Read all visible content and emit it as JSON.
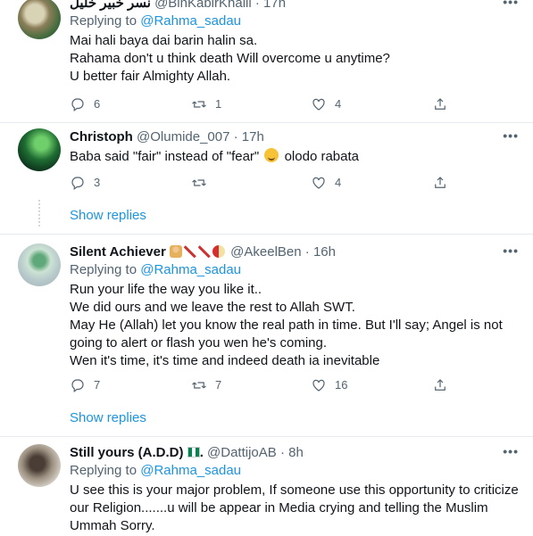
{
  "tweets": [
    {
      "name": "نسر خبير خليل",
      "handle": "@BinKabirKhalil",
      "time": "17h",
      "replying_label": "Replying to",
      "replying_to": "@Rahma_sadau",
      "lines": [
        "Mai hali baya dai barin halin sa.",
        "Rahama don't u think death Will overcome u anytime?",
        "U better fair Almighty Allah."
      ],
      "replies": "6",
      "retweets": "1",
      "likes": "4"
    },
    {
      "name": "Christoph",
      "handle": "@Olumide_007",
      "time": "17h",
      "text_before_emoji": "Baba said \"fair\" instead of \"fear\"",
      "text_after_emoji": "olodo rabata",
      "emoji": "face-with-tears-of-joy",
      "replies": "3",
      "retweets": "",
      "likes": "4",
      "show_replies": "Show replies"
    },
    {
      "name": "Silent Achiever",
      "name_emojis": [
        "person-icon",
        "syringe-icon",
        "syringe-icon",
        "pill-icon"
      ],
      "handle": "@AkeelBen",
      "time": "16h",
      "replying_label": "Replying to",
      "replying_to": "@Rahma_sadau",
      "lines": [
        "Run your life the way you like it..",
        "We did ours and we leave the rest to Allah SWT.",
        "May He (Allah) let you know the real path in time. But I'll say; Angel is not",
        "going to alert or flash you wen he's coming.",
        "Wen it's time, it's time and indeed death ia inevitable"
      ],
      "replies": "7",
      "retweets": "7",
      "likes": "16",
      "show_replies": "Show replies"
    },
    {
      "name": "Still yours (A.D.D)",
      "name_suffix": ".",
      "handle": "@DattijoAB",
      "time": "8h",
      "replying_label": "Replying to",
      "replying_to": "@Rahma_sadau",
      "lines": [
        "U see this is your major problem, If someone use this opportunity to criticize",
        "our Religion.......u will be appear in Media crying and telling the Muslim",
        "Ummah Sorry."
      ]
    }
  ],
  "colors": {
    "link": "#1b95e0",
    "muted": "#536471",
    "divider": "#e6ecf0"
  }
}
